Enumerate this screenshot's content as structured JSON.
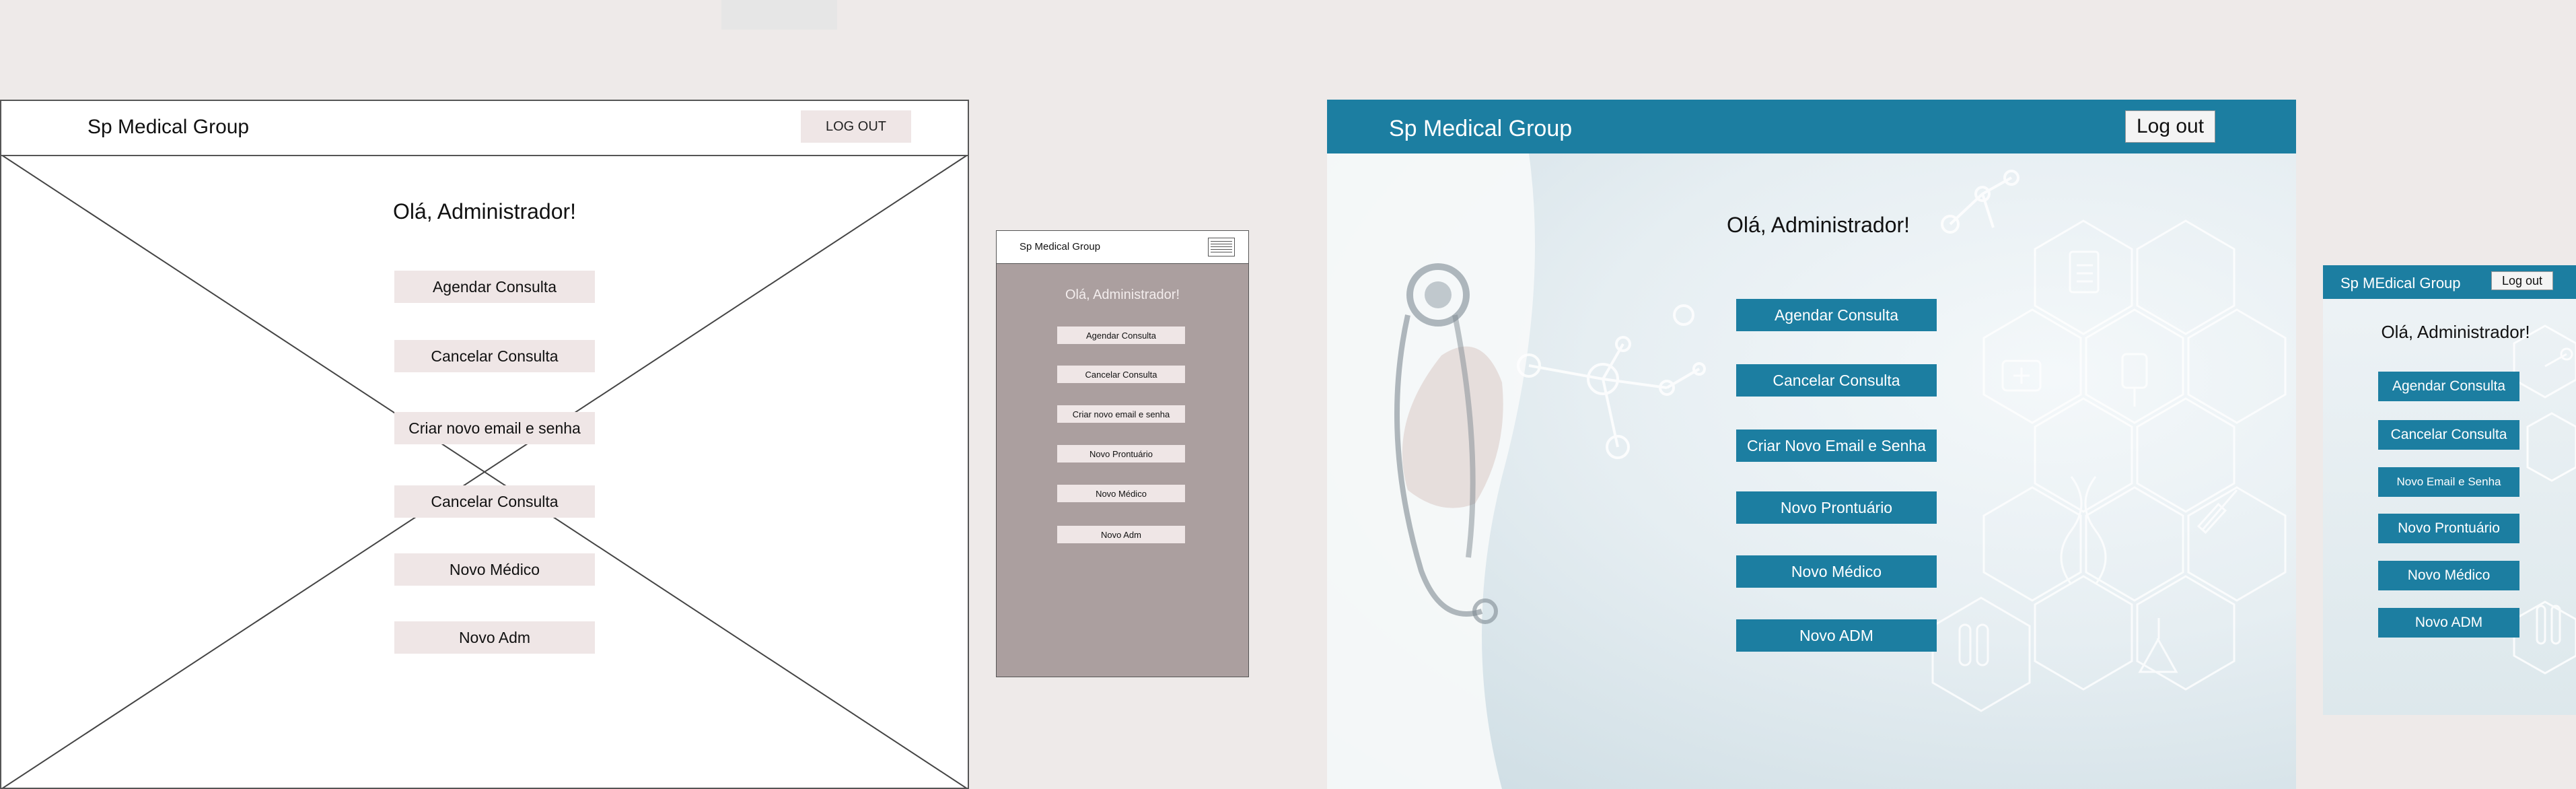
{
  "wireframe_desktop": {
    "title": "Sp Medical Group",
    "logout": "LOG OUT",
    "greeting": "Olá, Administrador!",
    "buttons": [
      "Agendar  Consulta",
      "Cancelar Consulta",
      "Criar novo email e senha",
      "Cancelar Consulta",
      "Novo Médico",
      "Novo Adm"
    ]
  },
  "wireframe_mobile": {
    "title": "Sp Medical Group",
    "menu_icon": "hamburger-menu-icon",
    "greeting": "Olá, Administrador!",
    "buttons": [
      "Agendar  Consulta",
      "Cancelar Consulta",
      "Criar novo email e senha",
      "Novo Prontuário",
      "Novo Médico",
      "Novo Adm"
    ]
  },
  "styled_desktop": {
    "title": "Sp Medical Group",
    "logout": "Log out",
    "greeting": "Olá, Administrador!",
    "buttons": [
      "Agendar Consulta",
      "Cancelar Consulta",
      "Criar Novo Email e Senha",
      "Novo Prontuário",
      "Novo Médico",
      "Novo ADM"
    ]
  },
  "styled_mobile": {
    "title": "Sp MEdical Group",
    "logout": "Log out",
    "greeting": "Olá, Administrador!",
    "buttons": [
      "Agendar Consulta",
      "Cancelar Consulta",
      "Novo Email e Senha",
      "Novo Prontuário",
      "Novo Médico",
      "Novo ADM"
    ]
  },
  "colors": {
    "brand": "#1c7ea1",
    "wireframe_button": "#efe6e6",
    "mobile_wireframe_bg": "#ab9f9f",
    "canvas": "#eeeae9"
  }
}
